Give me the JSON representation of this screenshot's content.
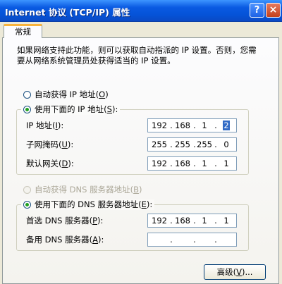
{
  "window": {
    "title": "Internet 协议 (TCP/IP) 属性",
    "help_button": "?",
    "close_button": "×"
  },
  "tabs": [
    {
      "label": "常规"
    }
  ],
  "intro_text": "如果网络支持此功能，则可以获取自动指派的 IP 设置。否则，您需要从网络系统管理员处获得适当的 IP 设置。",
  "ip_section": {
    "auto_option": {
      "label": "自动获得 IP 地址",
      "hotkey": "O",
      "checked": false
    },
    "manual_option": {
      "label": "使用下面的 IP 地址",
      "hotkey": "S",
      "checked": true
    },
    "fields": [
      {
        "label": "IP 地址",
        "hotkey": "I",
        "value": [
          "192",
          "168",
          "1",
          "2"
        ]
      },
      {
        "label": "子网掩码",
        "hotkey": "U",
        "value": [
          "255",
          "255",
          "255",
          "0"
        ]
      },
      {
        "label": "默认网关",
        "hotkey": "D",
        "value": [
          "192",
          "168",
          "1",
          "1"
        ]
      }
    ]
  },
  "dns_section": {
    "auto_option": {
      "label": "自动获得 DNS 服务器地址",
      "hotkey": "B",
      "checked": false,
      "disabled": true
    },
    "manual_option": {
      "label": "使用下面的 DNS 服务器地址",
      "hotkey": "E",
      "checked": true
    },
    "fields": [
      {
        "label": "首选 DNS 服务器",
        "hotkey": "P",
        "value": [
          "192",
          "168",
          "1",
          "1"
        ]
      },
      {
        "label": "备用 DNS 服务器",
        "hotkey": "A",
        "value": [
          "",
          "",
          "",
          ""
        ]
      }
    ]
  },
  "advanced_button": {
    "label": "高级",
    "hotkey": "V",
    "suffix": "..."
  },
  "colors": {
    "title_bar": "#0553d8",
    "tab_accent": "#f8b33c",
    "radio_dot": "#21a121",
    "dialog_bg": "#ece9d8"
  }
}
